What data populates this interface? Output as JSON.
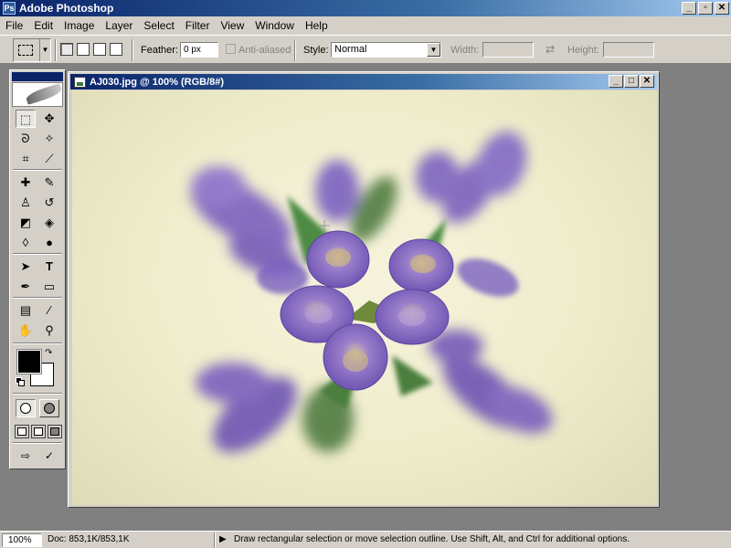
{
  "app": {
    "title": "Adobe Photoshop",
    "icon_letters": "Ps",
    "window_buttons": {
      "minimize": "_",
      "restore": "▫",
      "close": "✕"
    }
  },
  "menu": {
    "items": [
      "File",
      "Edit",
      "Image",
      "Layer",
      "Select",
      "Filter",
      "View",
      "Window",
      "Help"
    ]
  },
  "options": {
    "tool_preset_arrow": "▼",
    "feather_label": "Feather:",
    "feather_value": "0 px",
    "anti_aliased_label": "Anti-aliased",
    "style_label": "Style:",
    "style_value": "Normal",
    "style_arrow": "▼",
    "width_label": "Width:",
    "swap_icon": "⇄",
    "height_label": "Height:"
  },
  "toolbox": {
    "tools": [
      {
        "name": "rectangular-marquee-tool",
        "glyph": "⬚"
      },
      {
        "name": "move-tool",
        "glyph": "✥"
      },
      {
        "name": "lasso-tool",
        "glyph": "ᘐ"
      },
      {
        "name": "magic-wand-tool",
        "glyph": "✧"
      },
      {
        "name": "crop-tool",
        "glyph": "⌗"
      },
      {
        "name": "slice-tool",
        "glyph": "⟋"
      },
      {
        "name": "healing-brush-tool",
        "glyph": "✚"
      },
      {
        "name": "brush-tool",
        "glyph": "✎"
      },
      {
        "name": "clone-stamp-tool",
        "glyph": "♙"
      },
      {
        "name": "history-brush-tool",
        "glyph": "↺"
      },
      {
        "name": "eraser-tool",
        "glyph": "◩"
      },
      {
        "name": "paint-bucket-tool",
        "glyph": "◈"
      },
      {
        "name": "blur-tool",
        "glyph": "◊"
      },
      {
        "name": "burn-tool",
        "glyph": "●"
      },
      {
        "name": "path-selection-tool",
        "glyph": "➤"
      },
      {
        "name": "type-tool",
        "glyph": "T"
      },
      {
        "name": "pen-tool",
        "glyph": "✒"
      },
      {
        "name": "rectangle-tool",
        "glyph": "▭"
      },
      {
        "name": "notes-tool",
        "glyph": "▤"
      },
      {
        "name": "eyedropper-tool",
        "glyph": "⁄"
      },
      {
        "name": "hand-tool",
        "glyph": "✋"
      },
      {
        "name": "zoom-tool",
        "glyph": "⚲"
      }
    ],
    "swap_colors_glyph": "↷",
    "jump_to_imageready_glyph": "⇨",
    "jump_extra_glyph": "✓",
    "foreground_color": "#000000",
    "background_color": "#ffffff"
  },
  "document": {
    "title": "AJ030.jpg @ 100% (RGB/8#)",
    "buttons": {
      "minimize": "_",
      "maximize": "□",
      "close": "✕"
    }
  },
  "status": {
    "zoom": "100%",
    "doc_info": "Doc: 853,1K/853,1K",
    "arrow": "▶",
    "message": "Draw rectangular selection or move selection outline.  Use Shift, Alt, and Ctrl for additional options."
  }
}
